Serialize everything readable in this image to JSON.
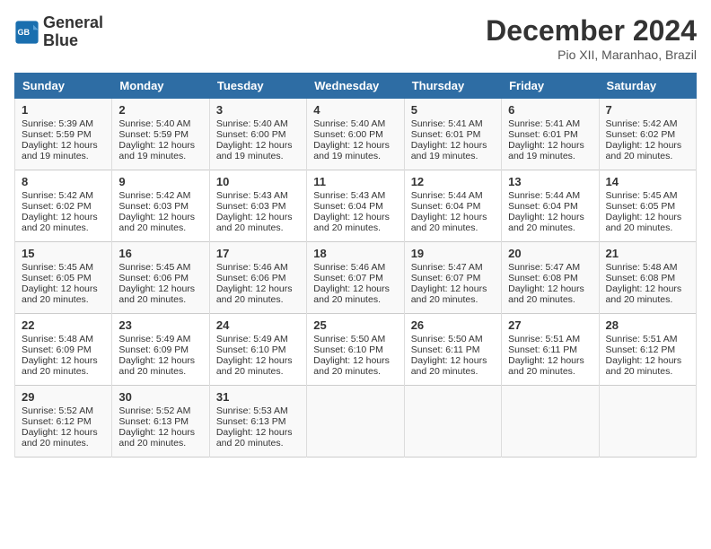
{
  "header": {
    "logo_line1": "General",
    "logo_line2": "Blue",
    "month_title": "December 2024",
    "subtitle": "Pio XII, Maranhao, Brazil"
  },
  "days_of_week": [
    "Sunday",
    "Monday",
    "Tuesday",
    "Wednesday",
    "Thursday",
    "Friday",
    "Saturday"
  ],
  "weeks": [
    [
      {
        "day": "1",
        "lines": [
          "Sunrise: 5:39 AM",
          "Sunset: 5:59 PM",
          "Daylight: 12 hours",
          "and 19 minutes."
        ]
      },
      {
        "day": "2",
        "lines": [
          "Sunrise: 5:40 AM",
          "Sunset: 5:59 PM",
          "Daylight: 12 hours",
          "and 19 minutes."
        ]
      },
      {
        "day": "3",
        "lines": [
          "Sunrise: 5:40 AM",
          "Sunset: 6:00 PM",
          "Daylight: 12 hours",
          "and 19 minutes."
        ]
      },
      {
        "day": "4",
        "lines": [
          "Sunrise: 5:40 AM",
          "Sunset: 6:00 PM",
          "Daylight: 12 hours",
          "and 19 minutes."
        ]
      },
      {
        "day": "5",
        "lines": [
          "Sunrise: 5:41 AM",
          "Sunset: 6:01 PM",
          "Daylight: 12 hours",
          "and 19 minutes."
        ]
      },
      {
        "day": "6",
        "lines": [
          "Sunrise: 5:41 AM",
          "Sunset: 6:01 PM",
          "Daylight: 12 hours",
          "and 19 minutes."
        ]
      },
      {
        "day": "7",
        "lines": [
          "Sunrise: 5:42 AM",
          "Sunset: 6:02 PM",
          "Daylight: 12 hours",
          "and 20 minutes."
        ]
      }
    ],
    [
      {
        "day": "8",
        "lines": [
          "Sunrise: 5:42 AM",
          "Sunset: 6:02 PM",
          "Daylight: 12 hours",
          "and 20 minutes."
        ]
      },
      {
        "day": "9",
        "lines": [
          "Sunrise: 5:42 AM",
          "Sunset: 6:03 PM",
          "Daylight: 12 hours",
          "and 20 minutes."
        ]
      },
      {
        "day": "10",
        "lines": [
          "Sunrise: 5:43 AM",
          "Sunset: 6:03 PM",
          "Daylight: 12 hours",
          "and 20 minutes."
        ]
      },
      {
        "day": "11",
        "lines": [
          "Sunrise: 5:43 AM",
          "Sunset: 6:04 PM",
          "Daylight: 12 hours",
          "and 20 minutes."
        ]
      },
      {
        "day": "12",
        "lines": [
          "Sunrise: 5:44 AM",
          "Sunset: 6:04 PM",
          "Daylight: 12 hours",
          "and 20 minutes."
        ]
      },
      {
        "day": "13",
        "lines": [
          "Sunrise: 5:44 AM",
          "Sunset: 6:04 PM",
          "Daylight: 12 hours",
          "and 20 minutes."
        ]
      },
      {
        "day": "14",
        "lines": [
          "Sunrise: 5:45 AM",
          "Sunset: 6:05 PM",
          "Daylight: 12 hours",
          "and 20 minutes."
        ]
      }
    ],
    [
      {
        "day": "15",
        "lines": [
          "Sunrise: 5:45 AM",
          "Sunset: 6:05 PM",
          "Daylight: 12 hours",
          "and 20 minutes."
        ]
      },
      {
        "day": "16",
        "lines": [
          "Sunrise: 5:45 AM",
          "Sunset: 6:06 PM",
          "Daylight: 12 hours",
          "and 20 minutes."
        ]
      },
      {
        "day": "17",
        "lines": [
          "Sunrise: 5:46 AM",
          "Sunset: 6:06 PM",
          "Daylight: 12 hours",
          "and 20 minutes."
        ]
      },
      {
        "day": "18",
        "lines": [
          "Sunrise: 5:46 AM",
          "Sunset: 6:07 PM",
          "Daylight: 12 hours",
          "and 20 minutes."
        ]
      },
      {
        "day": "19",
        "lines": [
          "Sunrise: 5:47 AM",
          "Sunset: 6:07 PM",
          "Daylight: 12 hours",
          "and 20 minutes."
        ]
      },
      {
        "day": "20",
        "lines": [
          "Sunrise: 5:47 AM",
          "Sunset: 6:08 PM",
          "Daylight: 12 hours",
          "and 20 minutes."
        ]
      },
      {
        "day": "21",
        "lines": [
          "Sunrise: 5:48 AM",
          "Sunset: 6:08 PM",
          "Daylight: 12 hours",
          "and 20 minutes."
        ]
      }
    ],
    [
      {
        "day": "22",
        "lines": [
          "Sunrise: 5:48 AM",
          "Sunset: 6:09 PM",
          "Daylight: 12 hours",
          "and 20 minutes."
        ]
      },
      {
        "day": "23",
        "lines": [
          "Sunrise: 5:49 AM",
          "Sunset: 6:09 PM",
          "Daylight: 12 hours",
          "and 20 minutes."
        ]
      },
      {
        "day": "24",
        "lines": [
          "Sunrise: 5:49 AM",
          "Sunset: 6:10 PM",
          "Daylight: 12 hours",
          "and 20 minutes."
        ]
      },
      {
        "day": "25",
        "lines": [
          "Sunrise: 5:50 AM",
          "Sunset: 6:10 PM",
          "Daylight: 12 hours",
          "and 20 minutes."
        ]
      },
      {
        "day": "26",
        "lines": [
          "Sunrise: 5:50 AM",
          "Sunset: 6:11 PM",
          "Daylight: 12 hours",
          "and 20 minutes."
        ]
      },
      {
        "day": "27",
        "lines": [
          "Sunrise: 5:51 AM",
          "Sunset: 6:11 PM",
          "Daylight: 12 hours",
          "and 20 minutes."
        ]
      },
      {
        "day": "28",
        "lines": [
          "Sunrise: 5:51 AM",
          "Sunset: 6:12 PM",
          "Daylight: 12 hours",
          "and 20 minutes."
        ]
      }
    ],
    [
      {
        "day": "29",
        "lines": [
          "Sunrise: 5:52 AM",
          "Sunset: 6:12 PM",
          "Daylight: 12 hours",
          "and 20 minutes."
        ]
      },
      {
        "day": "30",
        "lines": [
          "Sunrise: 5:52 AM",
          "Sunset: 6:13 PM",
          "Daylight: 12 hours",
          "and 20 minutes."
        ]
      },
      {
        "day": "31",
        "lines": [
          "Sunrise: 5:53 AM",
          "Sunset: 6:13 PM",
          "Daylight: 12 hours",
          "and 20 minutes."
        ]
      },
      {
        "day": "",
        "lines": []
      },
      {
        "day": "",
        "lines": []
      },
      {
        "day": "",
        "lines": []
      },
      {
        "day": "",
        "lines": []
      }
    ]
  ]
}
